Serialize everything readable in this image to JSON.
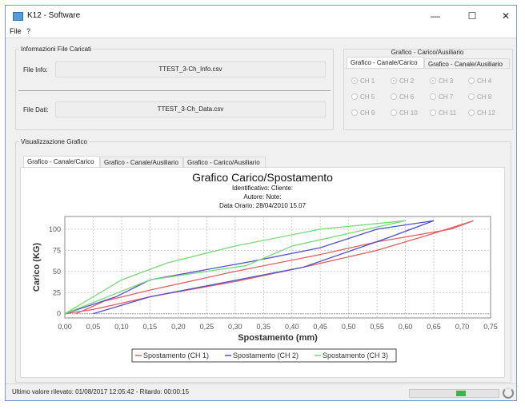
{
  "window": {
    "title": "K12 - Software",
    "controls": {
      "minimize": "—",
      "maximize": "☐",
      "close": "✕"
    }
  },
  "menu": {
    "items": [
      "File",
      "?"
    ]
  },
  "file_info_panel": {
    "legend": "Informazioni File Caricati",
    "file_info_label": "File Info:",
    "file_info_value": "TTEST_3-Ch_Info.csv",
    "file_data_label": "File Dati:",
    "file_data_value": "TTEST_3-Ch_Data.csv"
  },
  "channel_panel": {
    "top_tab": "Grafico - Carico/Ausiliario",
    "tabs": [
      "Grafico - Canale/Carico",
      "Grafico - Canale/Ausiliario"
    ],
    "active_tab": 0,
    "channels": [
      {
        "label": "CH 1",
        "selected": true
      },
      {
        "label": "CH 2",
        "selected": true
      },
      {
        "label": "CH 3",
        "selected": true
      },
      {
        "label": "CH 4",
        "selected": false
      },
      {
        "label": "CH 5",
        "selected": false
      },
      {
        "label": "CH 6",
        "selected": false
      },
      {
        "label": "CH 7",
        "selected": false
      },
      {
        "label": "CH 8",
        "selected": false
      },
      {
        "label": "CH 9",
        "selected": false
      },
      {
        "label": "CH 10",
        "selected": false
      },
      {
        "label": "CH 11",
        "selected": false
      },
      {
        "label": "CH 12",
        "selected": false
      }
    ]
  },
  "graph_panel": {
    "legend": "Visualizzazione Grafico",
    "tabs": [
      "Grafico - Canale/Carico",
      "Grafico - Canale/Ausiliario",
      "Grafico - Carico/Ausiliario"
    ],
    "active_tab": 0
  },
  "chart_data": {
    "type": "line",
    "title": "Grafico Carico/Spostamento",
    "subtitle_lines": [
      "Identificativo:    Cliente:",
      "Autore:    Note:",
      "Data Orario: 28/04/2010 15.07"
    ],
    "xlabel": "Spostamento (mm)",
    "ylabel": "Carico (KG)",
    "xlim": [
      0,
      0.75
    ],
    "ylim": [
      0,
      115
    ],
    "x_ticks": [
      "0,00",
      "0,05",
      "0,10",
      "0,15",
      "0,20",
      "0,25",
      "0,30",
      "0,35",
      "0,40",
      "0,45",
      "0,50",
      "0,55",
      "0,60",
      "0,65",
      "0,70",
      "0,75"
    ],
    "y_ticks": [
      "0",
      "25",
      "50",
      "75",
      "100"
    ],
    "grid": true,
    "legend_position": "bottom",
    "series": [
      {
        "name": "Spostamento (CH 1)",
        "color": "#e06060",
        "x": [
          0.0,
          0.05,
          0.15,
          0.3,
          0.42,
          0.55,
          0.65,
          0.72,
          0.68,
          0.55,
          0.45,
          0.3,
          0.15,
          0.07,
          0.02
        ],
        "y": [
          0,
          5,
          20,
          38,
          55,
          75,
          95,
          110,
          100,
          85,
          70,
          50,
          28,
          15,
          0
        ]
      },
      {
        "name": "Spostamento (CH 2)",
        "color": "#5050c8",
        "x": [
          0.0,
          0.09,
          0.15,
          0.33,
          0.45,
          0.55,
          0.65,
          0.57,
          0.42,
          0.15,
          0.05
        ],
        "y": [
          0,
          20,
          40,
          62,
          78,
          100,
          110,
          90,
          55,
          20,
          0
        ],
        "y_note": "loop"
      },
      {
        "name": "Spostamento (CH 3)",
        "color": "#78d878",
        "x": [
          0.0,
          0.1,
          0.18,
          0.3,
          0.45,
          0.6,
          0.4,
          0.32,
          0.15,
          0.0
        ],
        "y": [
          0,
          40,
          60,
          80,
          100,
          110,
          80,
          57,
          40,
          0
        ]
      }
    ]
  },
  "status": {
    "text": "Ultimo valore rilevato: 01/08/2017 12:05:42 - Ritardo: 00:00:15",
    "progress_fraction": 0.6
  }
}
